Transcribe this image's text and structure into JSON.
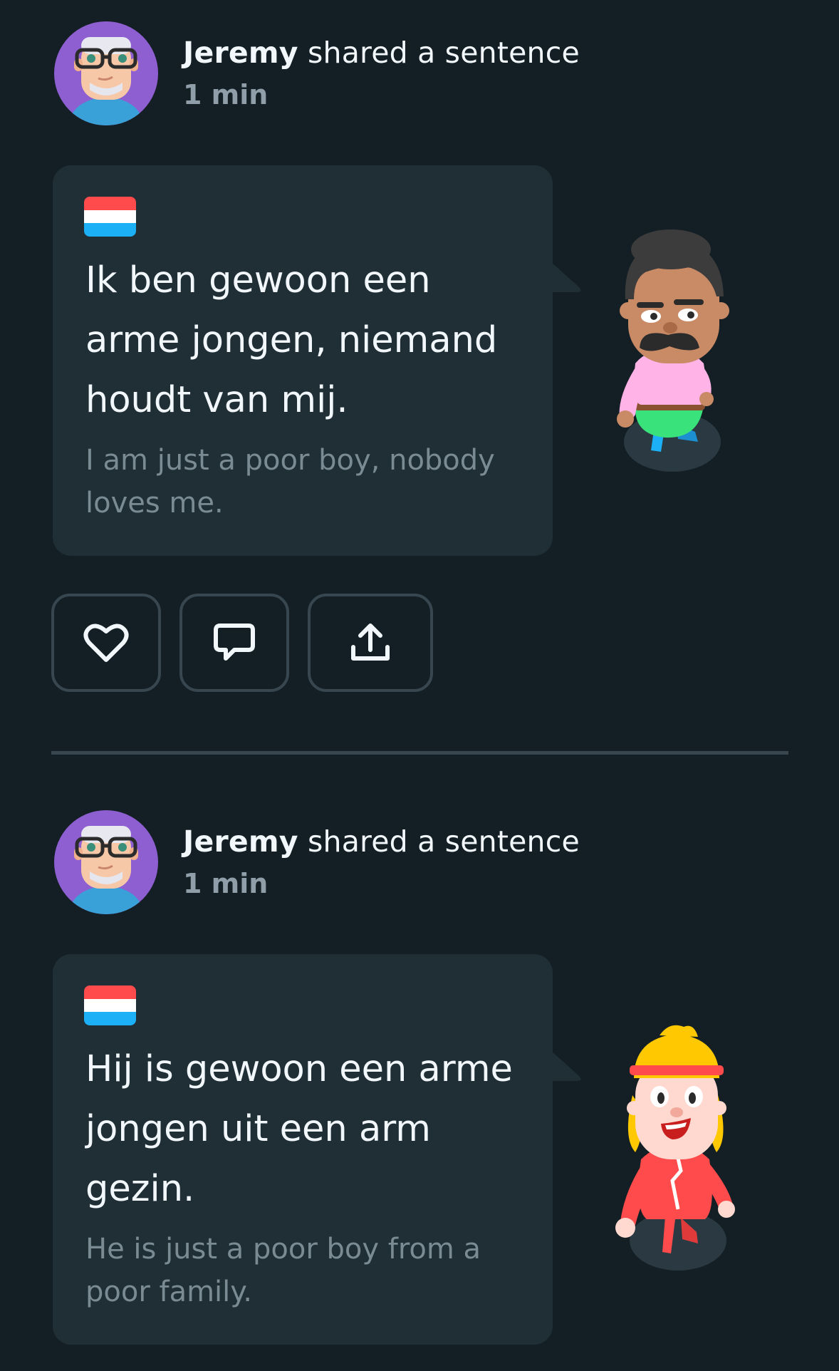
{
  "posts": [
    {
      "author": "Jeremy",
      "action_text": " shared a sentence",
      "time": "1 min",
      "flag_icon": "netherlands-flag-icon",
      "sentence": "Ik ben gewoon een arme jongen, niemand houdt van mij.",
      "translation": "I am just a poor boy, nobody loves me.",
      "character": "mustache-man-character"
    },
    {
      "author": "Jeremy",
      "action_text": " shared a sentence",
      "time": "1 min",
      "flag_icon": "netherlands-flag-icon",
      "sentence": "Hij is gewoon een arme jongen uit een arm gezin.",
      "translation": "He is just a poor boy from a poor family.",
      "character": "headband-girl-character"
    }
  ],
  "actions": {
    "like_icon": "heart-icon",
    "comment_icon": "speech-bubble-icon",
    "share_icon": "share-upload-icon"
  },
  "colors": {
    "background": "#131f24",
    "card": "#202f36",
    "border": "#37464f",
    "text_primary": "#f1f7fb",
    "text_secondary": "#7b8b94",
    "flag_red": "#ff4b4b",
    "flag_blue": "#1cb0f6"
  }
}
